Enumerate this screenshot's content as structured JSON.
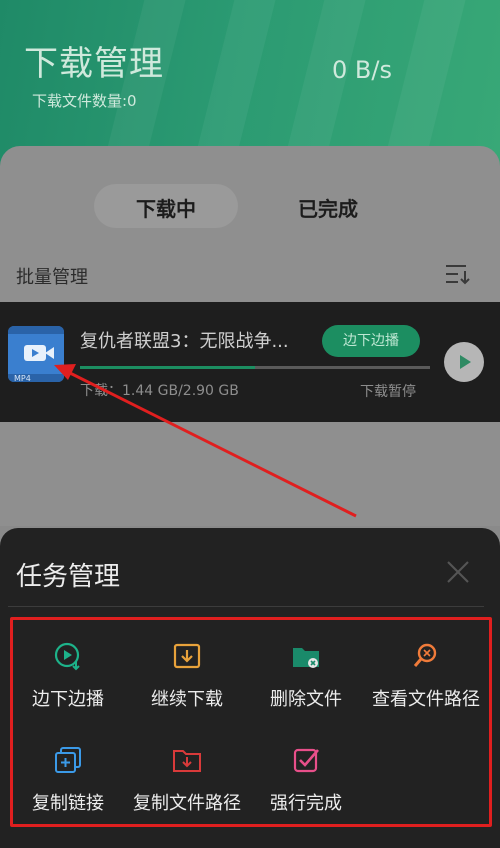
{
  "header": {
    "title": "下载管理",
    "subtitle": "下载文件数量:0",
    "speed": "0 B/s"
  },
  "tabs": {
    "downloading": "下载中",
    "completed": "已完成"
  },
  "batch_label": "批量管理",
  "task": {
    "file_type": "MP4",
    "name": "复仇者联盟3：无限战争...",
    "stream_button": "边下边播",
    "progress_percent": 50,
    "size_text": "下载：1.44 GB/2.90 GB",
    "status": "下载暂停"
  },
  "panel": {
    "title": "任务管理",
    "actions": [
      {
        "label": "边下边播",
        "icon": "play-circle-download-icon",
        "color": "#1db38a"
      },
      {
        "label": "继续下载",
        "icon": "download-box-icon",
        "color": "#e8a23b"
      },
      {
        "label": "删除文件",
        "icon": "folder-delete-icon",
        "color": "#1db38a"
      },
      {
        "label": "查看文件路径",
        "icon": "search-path-icon",
        "color": "#f07b3a"
      },
      {
        "label": "复制链接",
        "icon": "copy-link-icon",
        "color": "#3b9ae8"
      },
      {
        "label": "复制文件路径",
        "icon": "folder-download-icon",
        "color": "#d93a3a"
      },
      {
        "label": "强行完成",
        "icon": "force-complete-icon",
        "color": "#e84f8a"
      }
    ]
  },
  "colors": {
    "brand_green": "#1c8e61",
    "annotation_red": "#e01f1f"
  }
}
